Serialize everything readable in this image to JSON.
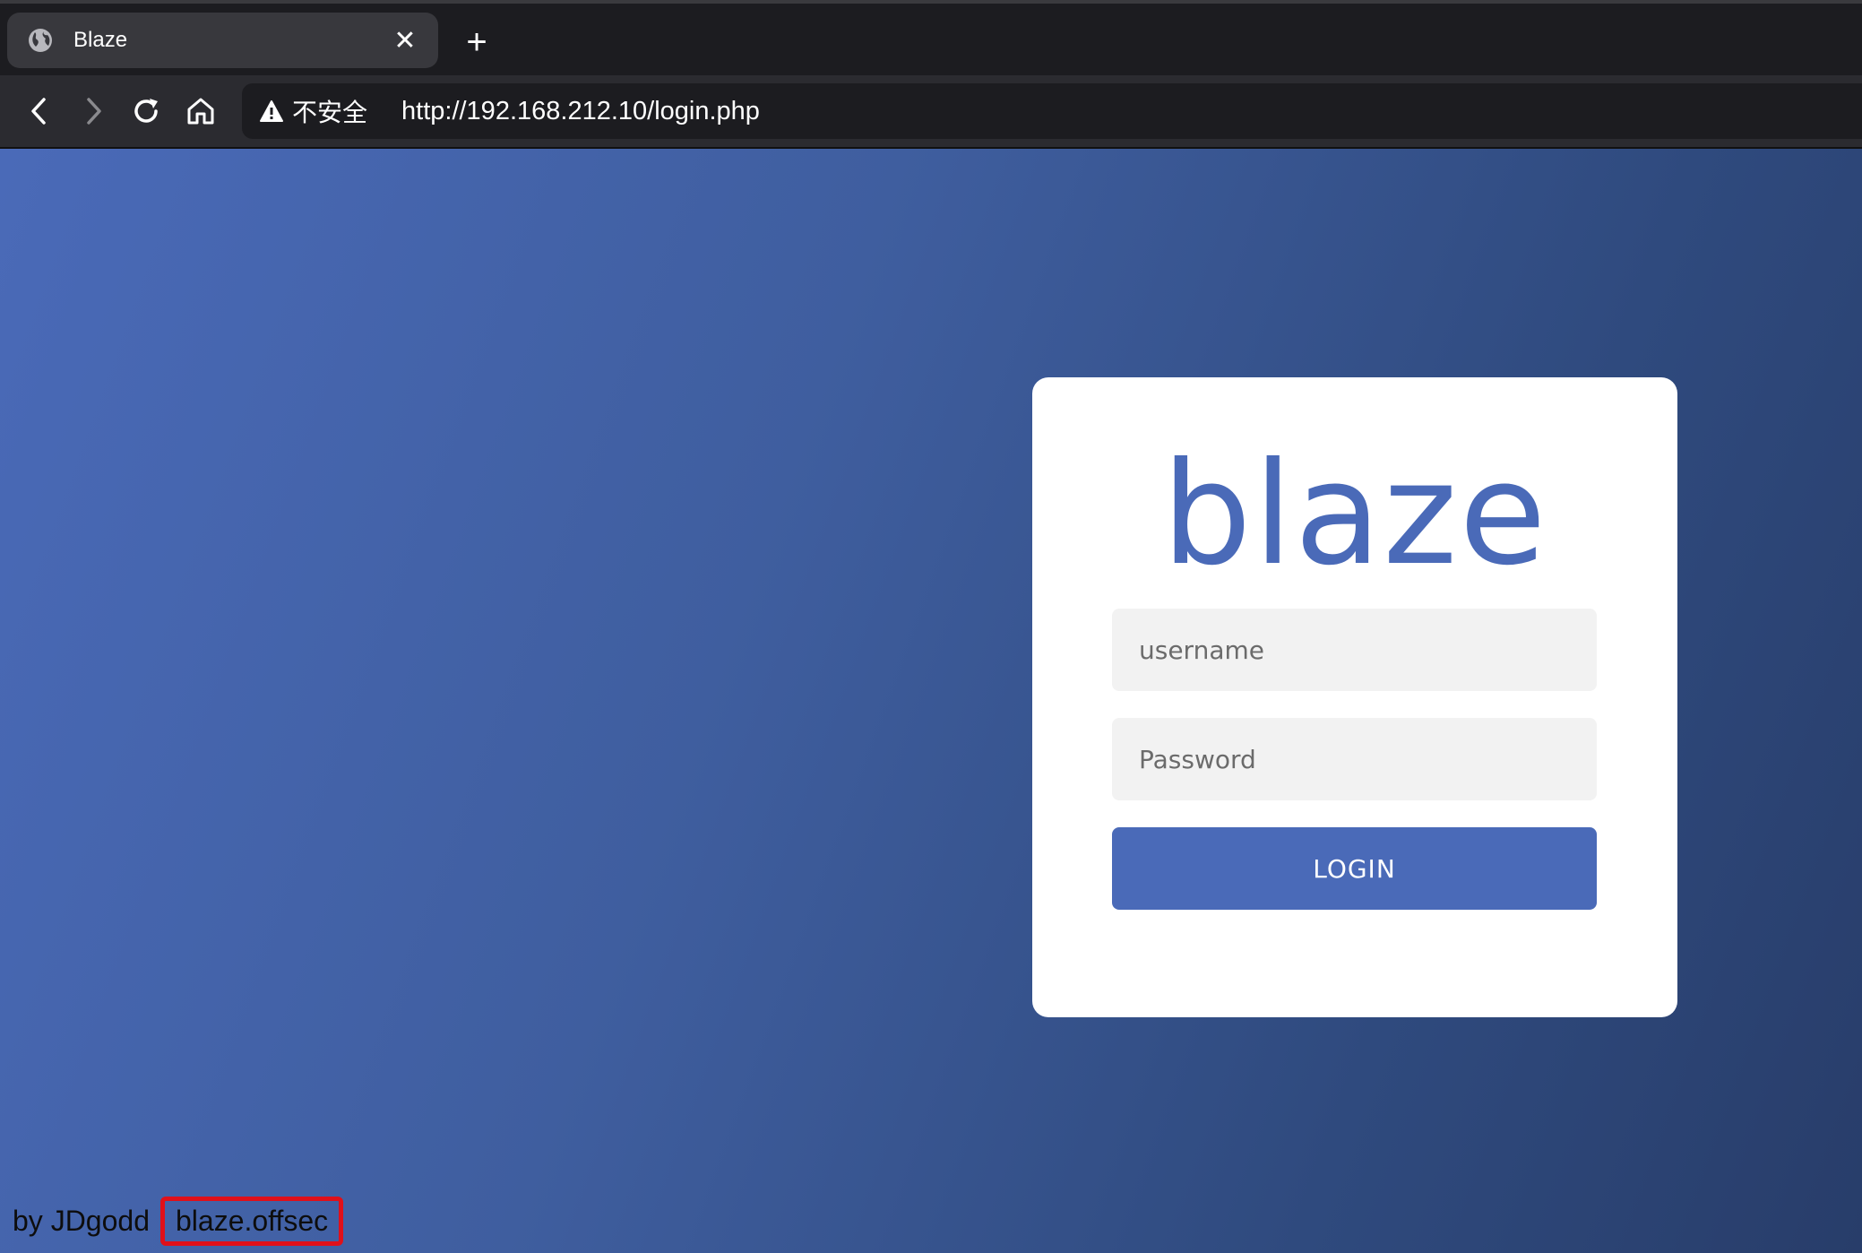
{
  "tab": {
    "title": "Blaze",
    "close_label": "✕",
    "new_tab_label": "+"
  },
  "toolbar": {
    "security_label": "不安全",
    "url": "http://192.168.212.10/login.php"
  },
  "page": {
    "logo": "blaze",
    "username_placeholder": "username",
    "password_placeholder": "Password",
    "login_label": "LOGIN",
    "footer_by": "by JDgodd",
    "footer_host": "blaze.offsec"
  },
  "colors": {
    "accent": "#4a6ab8",
    "highlight_box": "#e0101a",
    "field_bg": "#f2f2f2"
  },
  "icons": {
    "tab": "globe-icon",
    "back": "chevron-left-icon",
    "forward": "chevron-right-icon",
    "reload": "reload-icon",
    "home": "home-icon",
    "security": "warning-icon"
  }
}
